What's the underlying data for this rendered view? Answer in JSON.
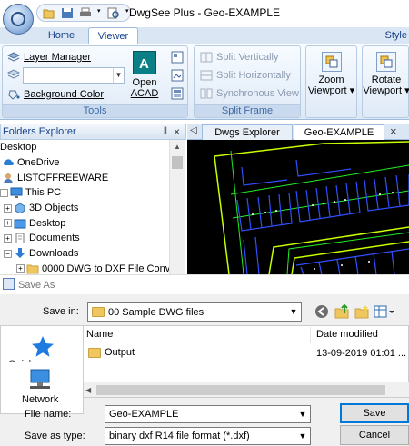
{
  "window": {
    "title": "DwgSee Plus - Geo-EXAMPLE"
  },
  "ribbon": {
    "tabs": [
      {
        "label": "Home"
      },
      {
        "label": "Viewer"
      }
    ],
    "style_label": "Style",
    "tools": {
      "layer_manager": "Layer Manager",
      "background_color": "Background Color",
      "open_acad_line1": "Open",
      "open_acad_line2": "ACAD",
      "group_label": "Tools"
    },
    "split_frame": {
      "split_vertically": "Split Vertically",
      "split_horizontally": "Split Horizontally",
      "synchronous_view": "Synchronous View",
      "group_label": "Split Frame"
    },
    "zoom": {
      "line1": "Zoom",
      "line2": "Viewport"
    },
    "rotate": {
      "line1": "Rotate",
      "line2": "Viewport"
    }
  },
  "folders_explorer": {
    "title": "Folders Explorer",
    "pin": "‖",
    "close": "×",
    "items": [
      {
        "label": "Desktop"
      },
      {
        "label": "OneDrive"
      },
      {
        "label": "LISTOFFREEWARE"
      },
      {
        "label": "This PC"
      },
      {
        "label": "3D Objects"
      },
      {
        "label": "Desktop"
      },
      {
        "label": "Documents"
      },
      {
        "label": "Downloads"
      },
      {
        "label": "0000 DWG to DXF File Conv"
      }
    ]
  },
  "doc_tabs": {
    "nav_prev": "◁",
    "tabs": [
      {
        "label": "Dwgs Explorer"
      },
      {
        "label": "Geo-EXAMPLE"
      }
    ],
    "close": "×"
  },
  "canvas": {
    "background": "#000000",
    "boundary_color": "#c8ff00",
    "road_color": "#22ee22",
    "lot_color": "#3050ff"
  },
  "save_dialog": {
    "title": "Save As",
    "save_in_label": "Save in:",
    "save_in_value": "00 Sample DWG files",
    "places": [
      {
        "label": "Quick access"
      },
      {
        "label": "Network"
      }
    ],
    "columns": {
      "name": "Name",
      "date": "Date modified"
    },
    "files": [
      {
        "name": "Output",
        "date": "13-09-2019 01:01 ..."
      }
    ],
    "file_name_label": "File name:",
    "file_name_value": "Geo-EXAMPLE",
    "save_as_type_label": "Save as type:",
    "save_as_type_value": "binary dxf R14 file format (*.dxf)",
    "save_button": "Save",
    "cancel_button": "Cancel"
  }
}
